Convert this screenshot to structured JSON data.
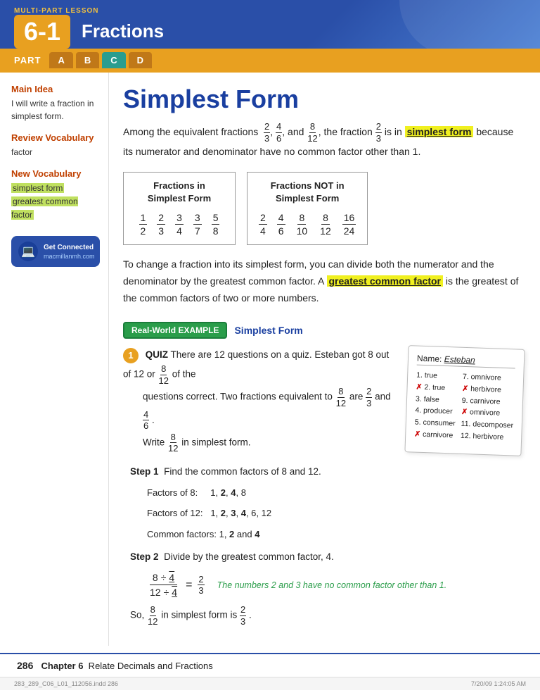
{
  "header": {
    "multi_part": "Multi-Part Lesson",
    "lesson_number": "6-1",
    "lesson_subject": "Fractions",
    "part_label": "PART",
    "tabs": [
      "A",
      "B",
      "C",
      "D"
    ],
    "active_tab": "C"
  },
  "sidebar": {
    "main_idea_title": "Main Idea",
    "main_idea_text": "I will write a fraction in simplest form.",
    "review_vocab_title": "Review Vocabulary",
    "review_vocab_item": "factor",
    "new_vocab_title": "New Vocabulary",
    "new_vocab_items": [
      "simplest form",
      "greatest common factor"
    ],
    "get_connected_label": "Get Connected",
    "get_connected_url": "macmillanmh.com"
  },
  "content": {
    "page_title": "Simplest Form",
    "intro": "Among the equivalent fractions",
    "fractions_intro": "2/3, 4/6, and 8/12",
    "intro_cont": ", the fraction 2/3 is in",
    "simplest_form_term": "simplest form",
    "intro_cont2": "because its numerator and denominator have no common factor other than 1.",
    "table_in_title": "Fractions in\nSimplest Form",
    "table_in_fracs": [
      [
        "1",
        "2"
      ],
      [
        "2",
        "3"
      ],
      [
        "3",
        "4"
      ],
      [
        "3",
        "7"
      ],
      [
        "5",
        "8"
      ]
    ],
    "table_not_title": "Fractions NOT in\nSimplest Form",
    "table_not_fracs": [
      [
        "2",
        "4"
      ],
      [
        "4",
        "6"
      ],
      [
        "8",
        "10"
      ],
      [
        "8",
        "12"
      ],
      [
        "16",
        "24"
      ]
    ],
    "body1": "To change a fraction into its simplest form, you can divide both the numerator and the denominator by the greatest common factor. A",
    "gcf_term": "greatest common factor",
    "body1_cont": "is the greatest of the common factors of two or more numbers.",
    "rw_badge": "Real-World",
    "rw_example": "EXAMPLE",
    "rw_title": "Simplest Form",
    "example_number": "1",
    "quiz_label": "QUIZ",
    "quiz_text1": "There are 12 questions on a quiz. Esteban got 8 out of 12 or",
    "quiz_frac": "8/12",
    "quiz_text2": "of the questions correct. Two fractions equivalent to",
    "quiz_frac2": "8/12",
    "quiz_text3": "are",
    "quiz_frac3": "2/3",
    "quiz_text4": "and",
    "quiz_frac4": "4/6",
    "quiz_text5": ". Write",
    "quiz_frac5": "8/12",
    "quiz_text6": "in simplest form.",
    "step1_label": "Step 1",
    "step1_text": "Find the common factors of 8 and 12.",
    "factors_of_8": "Factors of 8:",
    "factors_8_vals": "1, 2, 4, 8",
    "factors_8_bold": [
      "2",
      "4"
    ],
    "factors_of_12": "Factors of 12:",
    "factors_12_vals": "1, 2, 3, 4, 6, 12",
    "factors_12_bold": [
      "2",
      "3",
      "4"
    ],
    "common_factors": "Common factors: 1,",
    "common_bold": "2",
    "common_and": "and",
    "common_bold2": "4",
    "step2_label": "Step 2",
    "step2_text": "Divide by the greatest common factor, 4.",
    "step2_eq_top_num": "8",
    "step2_eq_top_div": "÷4",
    "step2_eq_bot_num": "12",
    "step2_eq_bot_div": "÷4",
    "step2_result_num": "2",
    "step2_result_den": "3",
    "step2_note": "The numbers 2 and 3 have no common factor other than 1.",
    "conclusion": "So,",
    "conclusion_frac": "8/12",
    "conclusion_text": "in simplest form is",
    "conclusion_result": "2/3",
    "conclusion_period": ".",
    "quiz_card": {
      "name_label": "Name:",
      "name_val": "Esteban",
      "items": [
        {
          "mark": "check",
          "text": "1. true",
          "col2_mark": "",
          "col2_text": "7. omnivore"
        },
        {
          "mark": "x",
          "text": "2. true",
          "col2_mark": "x",
          "col2_text": "herbivore"
        },
        {
          "mark": "",
          "text": "3. false",
          "col2_mark": "",
          "col2_text": "9. carnivore"
        },
        {
          "mark": "",
          "text": "4. producer",
          "col2_mark": "x",
          "col2_text": "omnivore"
        },
        {
          "mark": "",
          "text": "5. consumer",
          "col2_mark": "",
          "col2_text": "11. decomposer"
        },
        {
          "mark": "x",
          "text": "6. carnivore",
          "col2_mark": "",
          "col2_text": "12. herbivore"
        }
      ]
    }
  },
  "footer": {
    "page_number": "286",
    "chapter_text": "Chapter 6  Relate Decimals and Fractions"
  },
  "bottom_bar": {
    "file": "283_289_C06_L01_112056.indd 286",
    "date": "7/20/09  1:24:05 AM"
  }
}
